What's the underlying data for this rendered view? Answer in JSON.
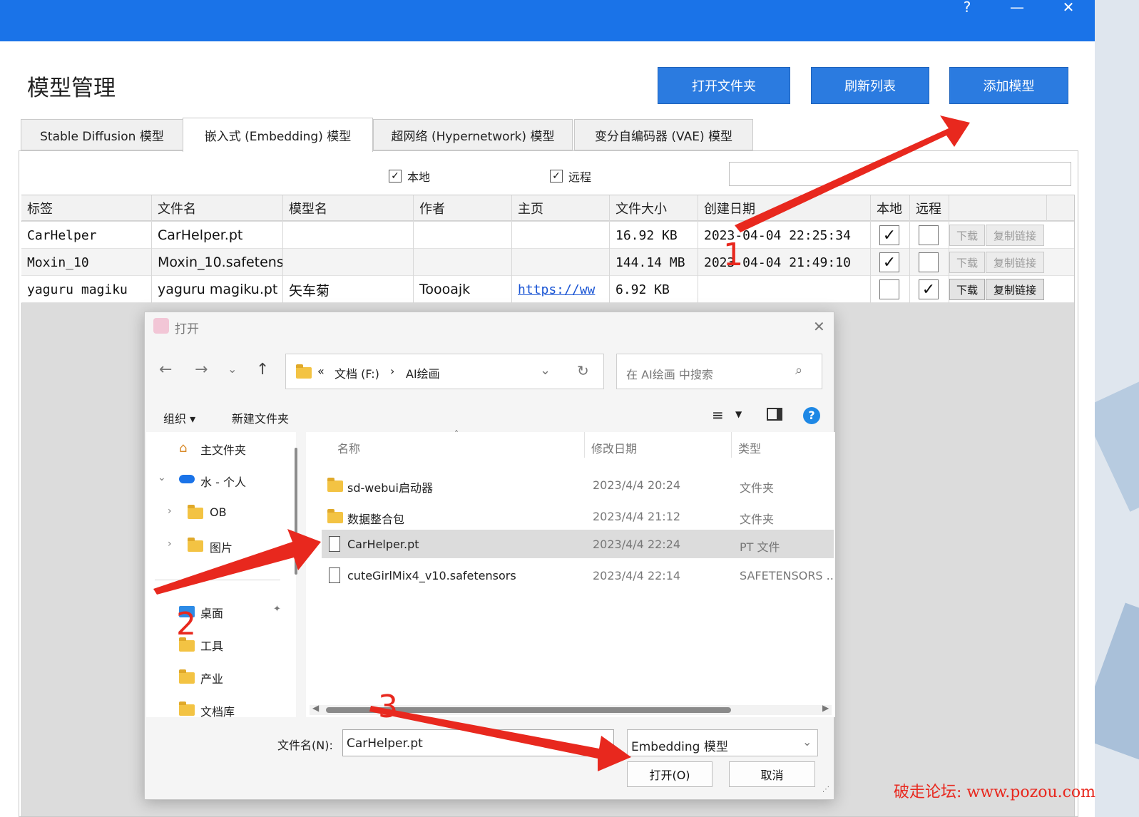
{
  "window": {
    "title_buttons": {
      "help": "?",
      "minimize": "—",
      "close": "✕"
    }
  },
  "page_title": "模型管理",
  "toolbar": {
    "open_folder": "打开文件夹",
    "refresh_list": "刷新列表",
    "add_model": "添加模型"
  },
  "tabs": [
    {
      "label": "Stable Diffusion 模型"
    },
    {
      "label": "嵌入式 (Embedding) 模型"
    },
    {
      "label": "超网络 (Hypernetwork) 模型"
    },
    {
      "label": "变分自编码器 (VAE) 模型"
    }
  ],
  "active_tab": 1,
  "filters": {
    "local_label": "本地",
    "remote_label": "远程",
    "local_checked": true,
    "remote_checked": true,
    "search_value": ""
  },
  "table": {
    "columns": [
      "标签",
      "文件名",
      "模型名",
      "作者",
      "主页",
      "文件大小",
      "创建日期",
      "本地",
      "远程"
    ],
    "download_label": "下载",
    "copy_link_label": "复制链接",
    "rows": [
      {
        "tag": "CarHelper",
        "filename": "CarHelper.pt",
        "model_name": "",
        "author": "",
        "homepage": "",
        "size": "16.92 KB",
        "created": "2023-04-04 22:25:34",
        "local": true,
        "remote": false,
        "actions_enabled": false
      },
      {
        "tag": "Moxin_10",
        "filename": "Moxin_10.safetens",
        "model_name": "",
        "author": "",
        "homepage": "",
        "size": "144.14 MB",
        "created": "2023-04-04 21:49:10",
        "local": true,
        "remote": false,
        "actions_enabled": false
      },
      {
        "tag": "yaguru magiku",
        "filename": "yaguru magiku.pt",
        "model_name": "矢车菊",
        "author": "Toooajk",
        "homepage": "https://ww",
        "size": "6.92 KB",
        "created": "",
        "local": false,
        "remote": true,
        "actions_enabled": true
      }
    ]
  },
  "dialog": {
    "title": "打开",
    "close": "✕",
    "breadcrumb": {
      "prefix": "«",
      "drive": "文档 (F:)",
      "sep": "›",
      "folder": "AI绘画"
    },
    "search_placeholder": "在 AI绘画 中搜索",
    "organize": "组织 ▾",
    "new_folder": "新建文件夹",
    "nav": [
      {
        "label": "主文件夹",
        "icon": "home-icon"
      },
      {
        "label": "水 - 个人",
        "icon": "cloud-icon"
      },
      {
        "label": "OB",
        "icon": "folder-icon"
      },
      {
        "label": "图片",
        "icon": "folder-icon"
      },
      {
        "label": "桌面",
        "icon": "desktop-icon"
      },
      {
        "label": "工具",
        "icon": "folder-icon"
      },
      {
        "label": "产业",
        "icon": "folder-icon"
      },
      {
        "label": "文档库",
        "icon": "folder-icon"
      }
    ],
    "columns": {
      "name": "名称",
      "modified": "修改日期",
      "type": "类型"
    },
    "files": [
      {
        "name": "sd-webui启动器",
        "modified": "2023/4/4 20:24",
        "type": "文件夹",
        "kind": "folder"
      },
      {
        "name": "数据整合包",
        "modified": "2023/4/4 21:12",
        "type": "文件夹",
        "kind": "folder"
      },
      {
        "name": "CarHelper.pt",
        "modified": "2023/4/4 22:24",
        "type": "PT 文件",
        "kind": "file",
        "selected": true
      },
      {
        "name": "cuteGirlMix4_v10.safetensors",
        "modified": "2023/4/4 22:14",
        "type": "SAFETENSORS ..",
        "kind": "file"
      }
    ],
    "filename_label": "文件名(N):",
    "filename_value": "CarHelper.pt",
    "filetype_value": "Embedding 模型",
    "open_button": "打开(O)",
    "cancel_button": "取消"
  },
  "annotations": {
    "step1": "1",
    "step2": "2",
    "step3": "3"
  },
  "watermark": "破走论坛: www.pozou.com",
  "colors": {
    "accent": "#1a73e8",
    "button": "#2b7be0",
    "annotation": "#e8281e"
  }
}
